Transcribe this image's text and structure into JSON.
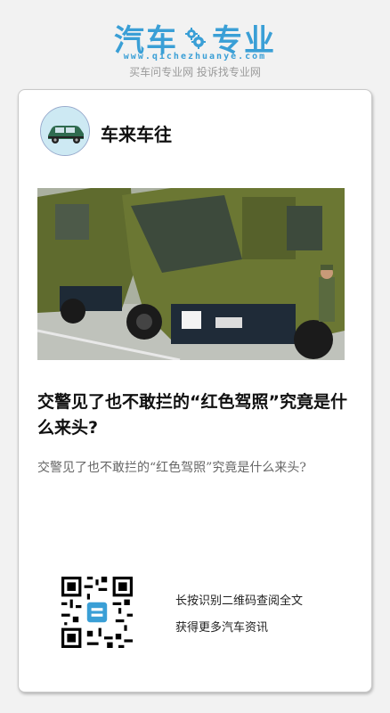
{
  "brand": {
    "logo_left": "汽车",
    "logo_right": "专业",
    "url": "www.qichezhuanye.com",
    "slogan": "买车问专业网 投诉找专业网",
    "color": "#3a9fd6"
  },
  "channel": {
    "name": "车来车往",
    "avatar_icon": "car-icon"
  },
  "article": {
    "title": "交警见了也不敢拦的“红色驾照”究竟是什么来头?",
    "summary": "交警见了也不敢拦的“红色驾照”究竟是什么来头?"
  },
  "footer": {
    "qr_line1": "长按识别二维码查阅全文",
    "qr_line2": "获得更多汽车资讯",
    "qr_icon": "qr-code-icon"
  }
}
